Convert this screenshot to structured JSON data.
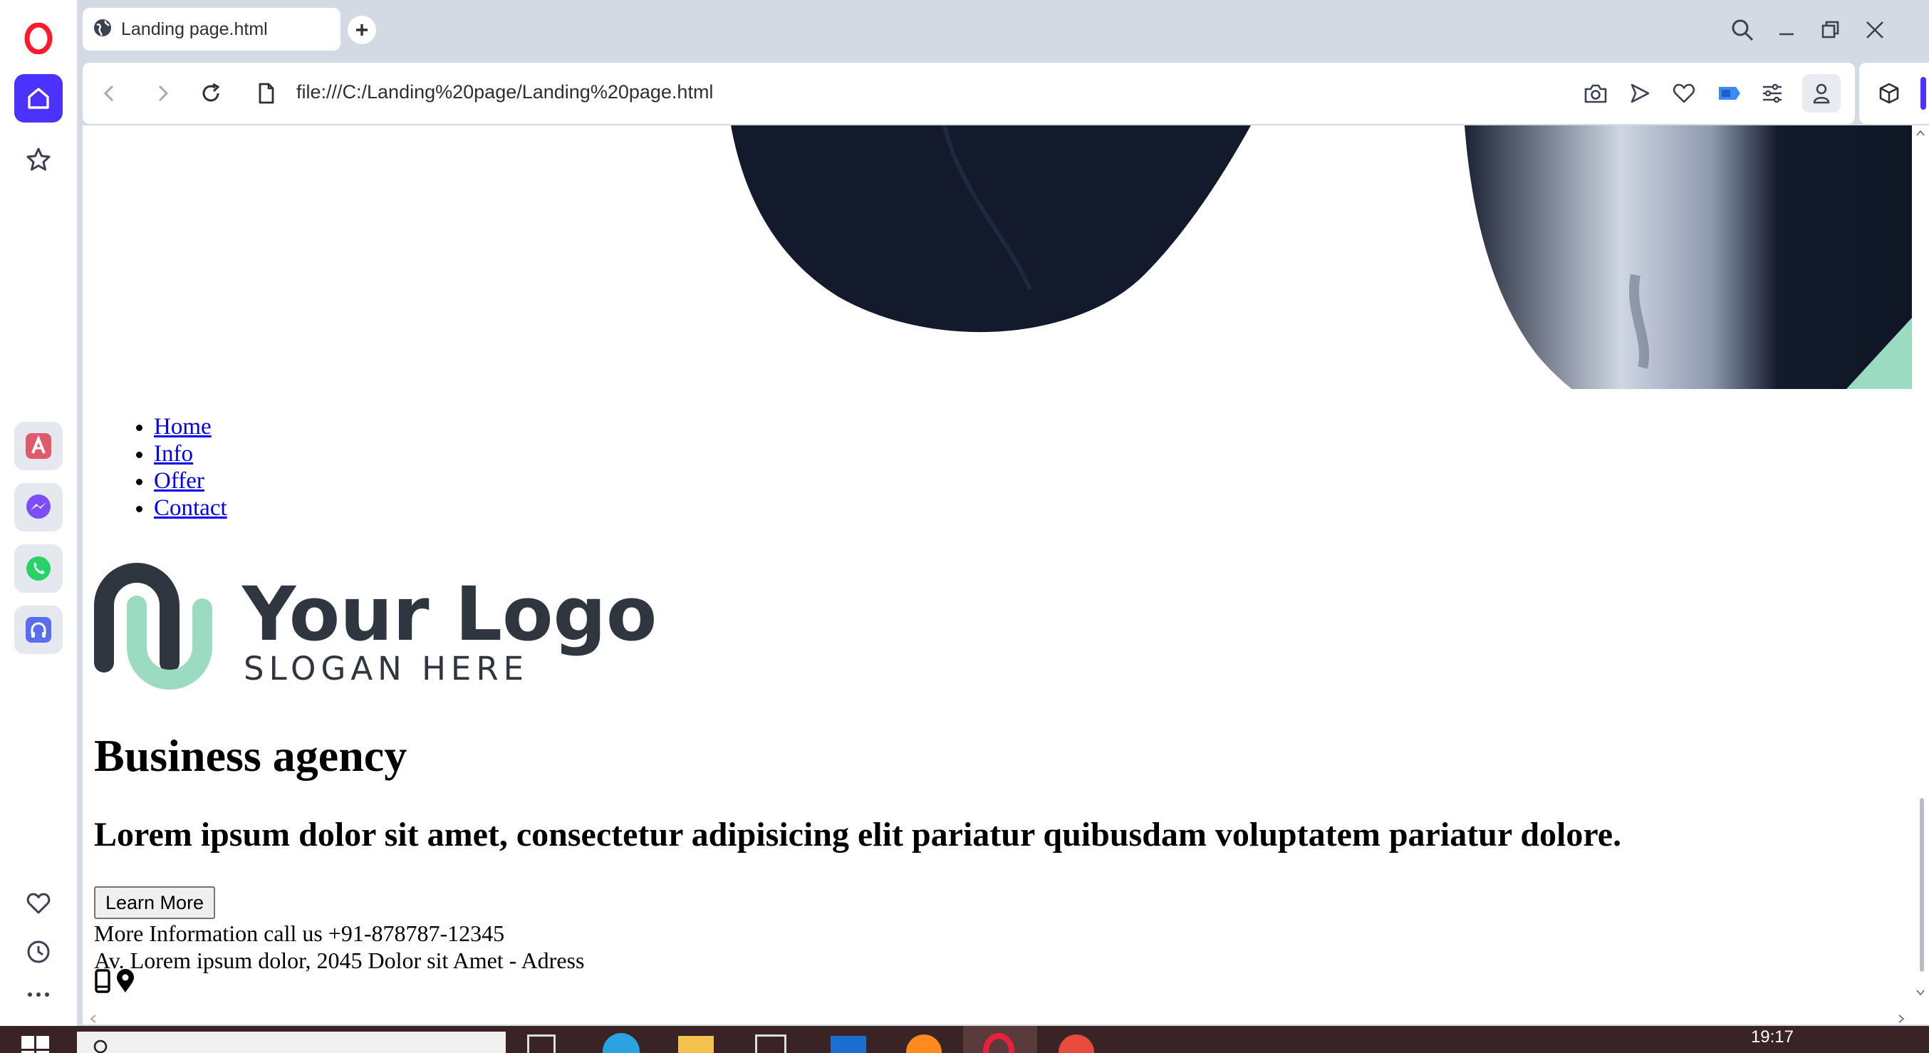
{
  "browser": {
    "tab_title": "Landing page.html",
    "url": "file:///C:/Landing%20page/Landing%20page.html"
  },
  "page": {
    "nav_links": [
      "Home",
      "Info",
      "Offer",
      "Contact"
    ],
    "logo": {
      "title": "Your Logo",
      "slogan": "SLOGAN HERE"
    },
    "heading": "Business agency",
    "subheading": "Lorem ipsum dolor sit amet, consectetur adipisicing elit pariatur quibusdam voluptatem pariatur dolore.",
    "button_label": "Learn More",
    "phone_line": "More Information call us +91-878787-12345",
    "address_line": "Av. Lorem ipsum dolor, 2045 Dolor sit Amet - Adress"
  },
  "taskbar": {
    "clock": "19:17"
  },
  "colors": {
    "accent": "#4b32ff",
    "logo_dark": "#2f3640",
    "logo_mint": "#9adbc2",
    "hero_dark": "#121a2b",
    "link": "#0000ee"
  },
  "icons": {
    "sidebar": [
      "opera-logo-icon",
      "home-icon",
      "star-icon",
      "aria-icon",
      "messenger-icon",
      "whatsapp-icon",
      "music-player-icon",
      "heart-icon",
      "history-icon",
      "more-icon"
    ],
    "toolbar": [
      "camera-icon",
      "send-icon",
      "heart-icon",
      "battery-icon",
      "easy-setup-icon",
      "profile-icon",
      "extensions-icon"
    ],
    "contact": [
      "phone-icon",
      "location-pin-icon"
    ]
  }
}
